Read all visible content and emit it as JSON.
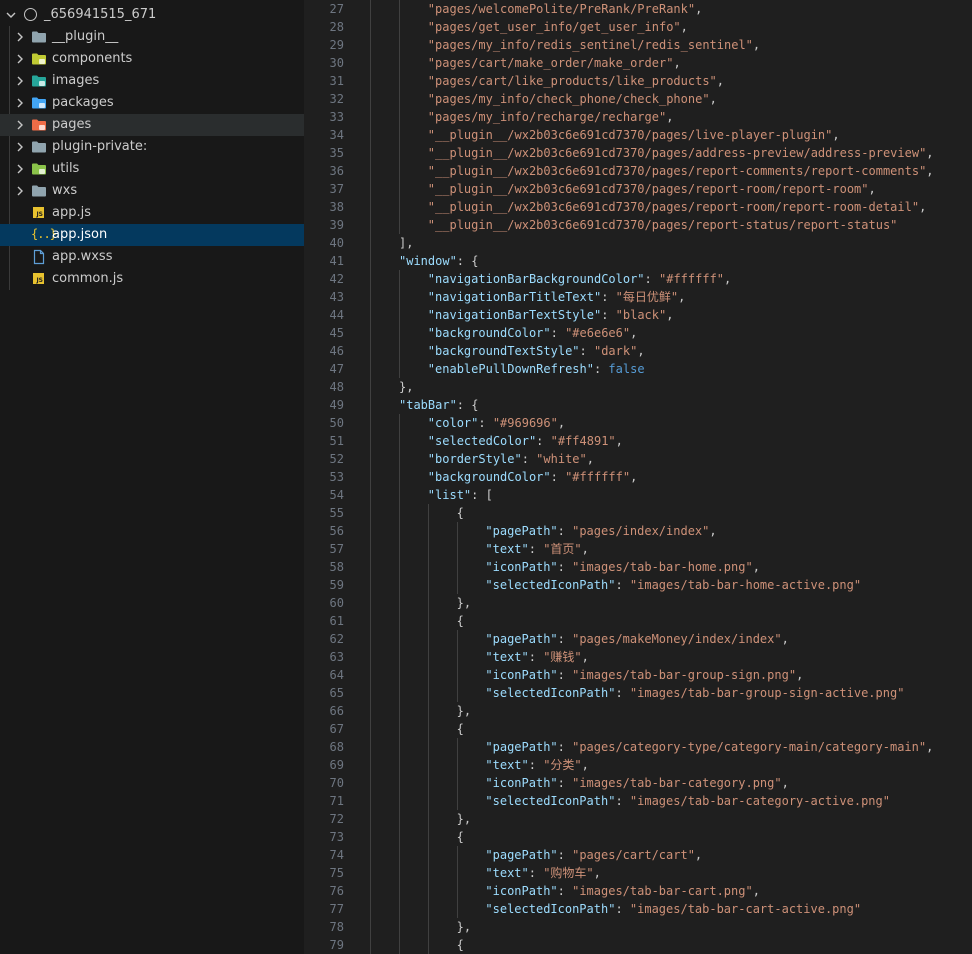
{
  "explorer": {
    "root_label": "_656941515_671",
    "items": [
      {
        "label": "__plugin__",
        "type": "folder",
        "icon": "folder-icon",
        "color": "#90a4ae"
      },
      {
        "label": "components",
        "type": "folder",
        "icon": "components-folder-icon",
        "color": "#c0ca33"
      },
      {
        "label": "images",
        "type": "folder",
        "icon": "images-folder-icon",
        "color": "#26a69a"
      },
      {
        "label": "packages",
        "type": "folder",
        "icon": "packages-folder-icon",
        "color": "#42a5f5"
      },
      {
        "label": "pages",
        "type": "folder",
        "icon": "pages-folder-icon",
        "color": "#ef6c47"
      },
      {
        "label": "plugin-private:",
        "type": "folder",
        "icon": "folder-icon",
        "color": "#90a4ae"
      },
      {
        "label": "utils",
        "type": "folder",
        "icon": "utils-folder-icon",
        "color": "#8bc34a"
      },
      {
        "label": "wxs",
        "type": "folder",
        "icon": "folder-icon",
        "color": "#90a4ae"
      },
      {
        "label": "app.js",
        "type": "file",
        "icon": "js-file-icon",
        "color": "#e8c22f"
      },
      {
        "label": "app.json",
        "type": "file",
        "icon": "json-file-icon",
        "color": "#e8c22f"
      },
      {
        "label": "app.wxss",
        "type": "file",
        "icon": "file-icon",
        "color": "#5e9ed6"
      },
      {
        "label": "common.js",
        "type": "file",
        "icon": "js-file-icon",
        "color": "#e8c22f"
      }
    ],
    "selected": "app.json",
    "hovered": "pages"
  },
  "editor": {
    "lines": [
      {
        "n": "27",
        "indent": 2,
        "tokens": [
          [
            "s",
            "\"pages/welcomePolite/PreRank/PreRank\""
          ],
          [
            "p",
            ","
          ]
        ]
      },
      {
        "n": "28",
        "indent": 2,
        "tokens": [
          [
            "s",
            "\"pages/get_user_info/get_user_info\""
          ],
          [
            "p",
            ","
          ]
        ]
      },
      {
        "n": "29",
        "indent": 2,
        "tokens": [
          [
            "s",
            "\"pages/my_info/redis_sentinel/redis_sentinel\""
          ],
          [
            "p",
            ","
          ]
        ]
      },
      {
        "n": "30",
        "indent": 2,
        "tokens": [
          [
            "s",
            "\"pages/cart/make_order/make_order\""
          ],
          [
            "p",
            ","
          ]
        ]
      },
      {
        "n": "31",
        "indent": 2,
        "tokens": [
          [
            "s",
            "\"pages/cart/like_products/like_products\""
          ],
          [
            "p",
            ","
          ]
        ]
      },
      {
        "n": "32",
        "indent": 2,
        "tokens": [
          [
            "s",
            "\"pages/my_info/check_phone/check_phone\""
          ],
          [
            "p",
            ","
          ]
        ]
      },
      {
        "n": "33",
        "indent": 2,
        "tokens": [
          [
            "s",
            "\"pages/my_info/recharge/recharge\""
          ],
          [
            "p",
            ","
          ]
        ]
      },
      {
        "n": "34",
        "indent": 2,
        "tokens": [
          [
            "s",
            "\"__plugin__/wx2b03c6e691cd7370/pages/live-player-plugin\""
          ],
          [
            "p",
            ","
          ]
        ]
      },
      {
        "n": "35",
        "indent": 2,
        "tokens": [
          [
            "s",
            "\"__plugin__/wx2b03c6e691cd7370/pages/address-preview/address-preview\""
          ],
          [
            "p",
            ","
          ]
        ]
      },
      {
        "n": "36",
        "indent": 2,
        "tokens": [
          [
            "s",
            "\"__plugin__/wx2b03c6e691cd7370/pages/report-comments/report-comments\""
          ],
          [
            "p",
            ","
          ]
        ]
      },
      {
        "n": "37",
        "indent": 2,
        "tokens": [
          [
            "s",
            "\"__plugin__/wx2b03c6e691cd7370/pages/report-room/report-room\""
          ],
          [
            "p",
            ","
          ]
        ]
      },
      {
        "n": "38",
        "indent": 2,
        "tokens": [
          [
            "s",
            "\"__plugin__/wx2b03c6e691cd7370/pages/report-room/report-room-detail\""
          ],
          [
            "p",
            ","
          ]
        ]
      },
      {
        "n": "39",
        "indent": 2,
        "tokens": [
          [
            "s",
            "\"__plugin__/wx2b03c6e691cd7370/pages/report-status/report-status\""
          ]
        ]
      },
      {
        "n": "40",
        "indent": 1,
        "tokens": [
          [
            "p",
            "],"
          ]
        ]
      },
      {
        "n": "41",
        "indent": 1,
        "tokens": [
          [
            "k",
            "\"window\""
          ],
          [
            "p",
            ": {"
          ]
        ]
      },
      {
        "n": "42",
        "indent": 2,
        "tokens": [
          [
            "k",
            "\"navigationBarBackgroundColor\""
          ],
          [
            "p",
            ": "
          ],
          [
            "s",
            "\"#ffffff\""
          ],
          [
            "p",
            ","
          ]
        ]
      },
      {
        "n": "43",
        "indent": 2,
        "tokens": [
          [
            "k",
            "\"navigationBarTitleText\""
          ],
          [
            "p",
            ": "
          ],
          [
            "s",
            "\"每日优鲜\""
          ],
          [
            "p",
            ","
          ]
        ]
      },
      {
        "n": "44",
        "indent": 2,
        "tokens": [
          [
            "k",
            "\"navigationBarTextStyle\""
          ],
          [
            "p",
            ": "
          ],
          [
            "s",
            "\"black\""
          ],
          [
            "p",
            ","
          ]
        ]
      },
      {
        "n": "45",
        "indent": 2,
        "tokens": [
          [
            "k",
            "\"backgroundColor\""
          ],
          [
            "p",
            ": "
          ],
          [
            "s",
            "\"#e6e6e6\""
          ],
          [
            "p",
            ","
          ]
        ]
      },
      {
        "n": "46",
        "indent": 2,
        "tokens": [
          [
            "k",
            "\"backgroundTextStyle\""
          ],
          [
            "p",
            ": "
          ],
          [
            "s",
            "\"dark\""
          ],
          [
            "p",
            ","
          ]
        ]
      },
      {
        "n": "47",
        "indent": 2,
        "tokens": [
          [
            "k",
            "\"enablePullDownRefresh\""
          ],
          [
            "p",
            ": "
          ],
          [
            "b",
            "false"
          ]
        ]
      },
      {
        "n": "48",
        "indent": 1,
        "tokens": [
          [
            "p",
            "},"
          ]
        ]
      },
      {
        "n": "49",
        "indent": 1,
        "tokens": [
          [
            "k",
            "\"tabBar\""
          ],
          [
            "p",
            ": {"
          ]
        ]
      },
      {
        "n": "50",
        "indent": 2,
        "tokens": [
          [
            "k",
            "\"color\""
          ],
          [
            "p",
            ": "
          ],
          [
            "s",
            "\"#969696\""
          ],
          [
            "p",
            ","
          ]
        ]
      },
      {
        "n": "51",
        "indent": 2,
        "tokens": [
          [
            "k",
            "\"selectedColor\""
          ],
          [
            "p",
            ": "
          ],
          [
            "s",
            "\"#ff4891\""
          ],
          [
            "p",
            ","
          ]
        ]
      },
      {
        "n": "52",
        "indent": 2,
        "tokens": [
          [
            "k",
            "\"borderStyle\""
          ],
          [
            "p",
            ": "
          ],
          [
            "s",
            "\"white\""
          ],
          [
            "p",
            ","
          ]
        ]
      },
      {
        "n": "53",
        "indent": 2,
        "tokens": [
          [
            "k",
            "\"backgroundColor\""
          ],
          [
            "p",
            ": "
          ],
          [
            "s",
            "\"#ffffff\""
          ],
          [
            "p",
            ","
          ]
        ]
      },
      {
        "n": "54",
        "indent": 2,
        "tokens": [
          [
            "k",
            "\"list\""
          ],
          [
            "p",
            ": ["
          ]
        ]
      },
      {
        "n": "55",
        "indent": 3,
        "tokens": [
          [
            "p",
            "{"
          ]
        ]
      },
      {
        "n": "56",
        "indent": 4,
        "tokens": [
          [
            "k",
            "\"pagePath\""
          ],
          [
            "p",
            ": "
          ],
          [
            "s",
            "\"pages/index/index\""
          ],
          [
            "p",
            ","
          ]
        ]
      },
      {
        "n": "57",
        "indent": 4,
        "tokens": [
          [
            "k",
            "\"text\""
          ],
          [
            "p",
            ": "
          ],
          [
            "s",
            "\"首页\""
          ],
          [
            "p",
            ","
          ]
        ]
      },
      {
        "n": "58",
        "indent": 4,
        "tokens": [
          [
            "k",
            "\"iconPath\""
          ],
          [
            "p",
            ": "
          ],
          [
            "s",
            "\"images/tab-bar-home.png\""
          ],
          [
            "p",
            ","
          ]
        ]
      },
      {
        "n": "59",
        "indent": 4,
        "tokens": [
          [
            "k",
            "\"selectedIconPath\""
          ],
          [
            "p",
            ": "
          ],
          [
            "s",
            "\"images/tab-bar-home-active.png\""
          ]
        ]
      },
      {
        "n": "60",
        "indent": 3,
        "tokens": [
          [
            "p",
            "},"
          ]
        ]
      },
      {
        "n": "61",
        "indent": 3,
        "tokens": [
          [
            "p",
            "{"
          ]
        ]
      },
      {
        "n": "62",
        "indent": 4,
        "tokens": [
          [
            "k",
            "\"pagePath\""
          ],
          [
            "p",
            ": "
          ],
          [
            "s",
            "\"pages/makeMoney/index/index\""
          ],
          [
            "p",
            ","
          ]
        ]
      },
      {
        "n": "63",
        "indent": 4,
        "tokens": [
          [
            "k",
            "\"text\""
          ],
          [
            "p",
            ": "
          ],
          [
            "s",
            "\"赚钱\""
          ],
          [
            "p",
            ","
          ]
        ]
      },
      {
        "n": "64",
        "indent": 4,
        "tokens": [
          [
            "k",
            "\"iconPath\""
          ],
          [
            "p",
            ": "
          ],
          [
            "s",
            "\"images/tab-bar-group-sign.png\""
          ],
          [
            "p",
            ","
          ]
        ]
      },
      {
        "n": "65",
        "indent": 4,
        "tokens": [
          [
            "k",
            "\"selectedIconPath\""
          ],
          [
            "p",
            ": "
          ],
          [
            "s",
            "\"images/tab-bar-group-sign-active.png\""
          ]
        ]
      },
      {
        "n": "66",
        "indent": 3,
        "tokens": [
          [
            "p",
            "},"
          ]
        ]
      },
      {
        "n": "67",
        "indent": 3,
        "tokens": [
          [
            "p",
            "{"
          ]
        ]
      },
      {
        "n": "68",
        "indent": 4,
        "tokens": [
          [
            "k",
            "\"pagePath\""
          ],
          [
            "p",
            ": "
          ],
          [
            "s",
            "\"pages/category-type/category-main/category-main\""
          ],
          [
            "p",
            ","
          ]
        ]
      },
      {
        "n": "69",
        "indent": 4,
        "tokens": [
          [
            "k",
            "\"text\""
          ],
          [
            "p",
            ": "
          ],
          [
            "s",
            "\"分类\""
          ],
          [
            "p",
            ","
          ]
        ]
      },
      {
        "n": "70",
        "indent": 4,
        "tokens": [
          [
            "k",
            "\"iconPath\""
          ],
          [
            "p",
            ": "
          ],
          [
            "s",
            "\"images/tab-bar-category.png\""
          ],
          [
            "p",
            ","
          ]
        ]
      },
      {
        "n": "71",
        "indent": 4,
        "tokens": [
          [
            "k",
            "\"selectedIconPath\""
          ],
          [
            "p",
            ": "
          ],
          [
            "s",
            "\"images/tab-bar-category-active.png\""
          ]
        ]
      },
      {
        "n": "72",
        "indent": 3,
        "tokens": [
          [
            "p",
            "},"
          ]
        ]
      },
      {
        "n": "73",
        "indent": 3,
        "tokens": [
          [
            "p",
            "{"
          ]
        ]
      },
      {
        "n": "74",
        "indent": 4,
        "tokens": [
          [
            "k",
            "\"pagePath\""
          ],
          [
            "p",
            ": "
          ],
          [
            "s",
            "\"pages/cart/cart\""
          ],
          [
            "p",
            ","
          ]
        ]
      },
      {
        "n": "75",
        "indent": 4,
        "tokens": [
          [
            "k",
            "\"text\""
          ],
          [
            "p",
            ": "
          ],
          [
            "s",
            "\"购物车\""
          ],
          [
            "p",
            ","
          ]
        ]
      },
      {
        "n": "76",
        "indent": 4,
        "tokens": [
          [
            "k",
            "\"iconPath\""
          ],
          [
            "p",
            ": "
          ],
          [
            "s",
            "\"images/tab-bar-cart.png\""
          ],
          [
            "p",
            ","
          ]
        ]
      },
      {
        "n": "77",
        "indent": 4,
        "tokens": [
          [
            "k",
            "\"selectedIconPath\""
          ],
          [
            "p",
            ": "
          ],
          [
            "s",
            "\"images/tab-bar-cart-active.png\""
          ]
        ]
      },
      {
        "n": "78",
        "indent": 3,
        "tokens": [
          [
            "p",
            "},"
          ]
        ]
      },
      {
        "n": "79",
        "indent": 3,
        "tokens": [
          [
            "p",
            "{"
          ]
        ]
      }
    ]
  }
}
